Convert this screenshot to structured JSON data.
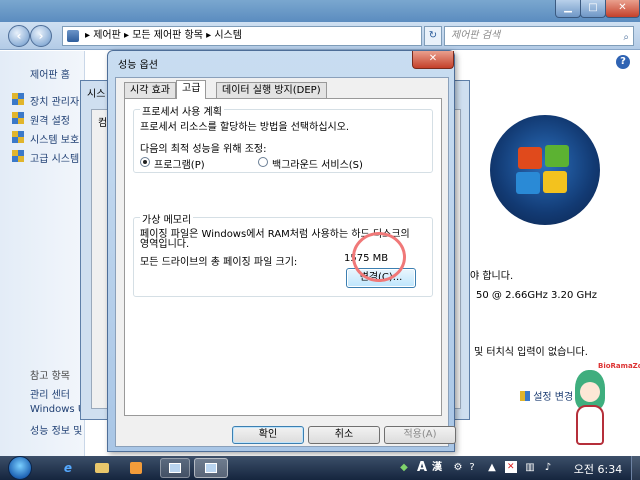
{
  "explorer": {
    "breadcrumb": [
      "제어판",
      "모든 제어판 항목",
      "시스템"
    ],
    "search_placeholder": "제어판 검색",
    "left_nav": {
      "home": "제어판 홈",
      "items": [
        "장치 관리자",
        "원격 설정",
        "시스템 보호",
        "고급 시스템"
      ],
      "see_also_header": "참고 항목",
      "see_also": [
        "관리 센터",
        "Windows Up",
        "성능 정보 및"
      ]
    },
    "right": {
      "activate_text": "l져야 합니다.",
      "cpu_text": "50 @ 2.66GHz  3.20 GHz",
      "pen_text": "및 터치식 입력이 없습니다.",
      "change_settings": "설정 변경"
    },
    "mascot_tag": "BioRamaZone"
  },
  "sysprop_dialog": {
    "tab_stub": "시스",
    "inner_stub": "컴"
  },
  "perf_dialog": {
    "title": "성능 옵션",
    "close_label": "✕",
    "tabs": [
      "시각 효과",
      "고급",
      "데이터 실행 방지(DEP)"
    ],
    "active_tab": "고급",
    "processor_group": {
      "title": "프로세서 사용 계획",
      "description": "프로세서 리소스를 할당하는 방법을 선택하십시오.",
      "optimize_label": "다음의 최적 성능을 위해 조정:",
      "options": [
        "프로그램(P)",
        "백그라운드 서비스(S)"
      ],
      "selected": "프로그램(P)"
    },
    "vm_group": {
      "title": "가상 메모리",
      "description_line1": "페이징 파일은 Windows에서 RAM처럼 사용하는 하드 디스크의",
      "description_line2": "영역입니다.",
      "total_label": "모든 드라이브의 총 페이징 파일 크기:",
      "total_value": "1575 MB",
      "change_button": "변경(C)..."
    },
    "buttons": {
      "ok": "확인",
      "cancel": "취소",
      "apply": "적용(A)"
    }
  },
  "taskbar": {
    "tray_ime_a": "A",
    "tray_ime_han": "漢",
    "clock": "오전 6:34"
  }
}
